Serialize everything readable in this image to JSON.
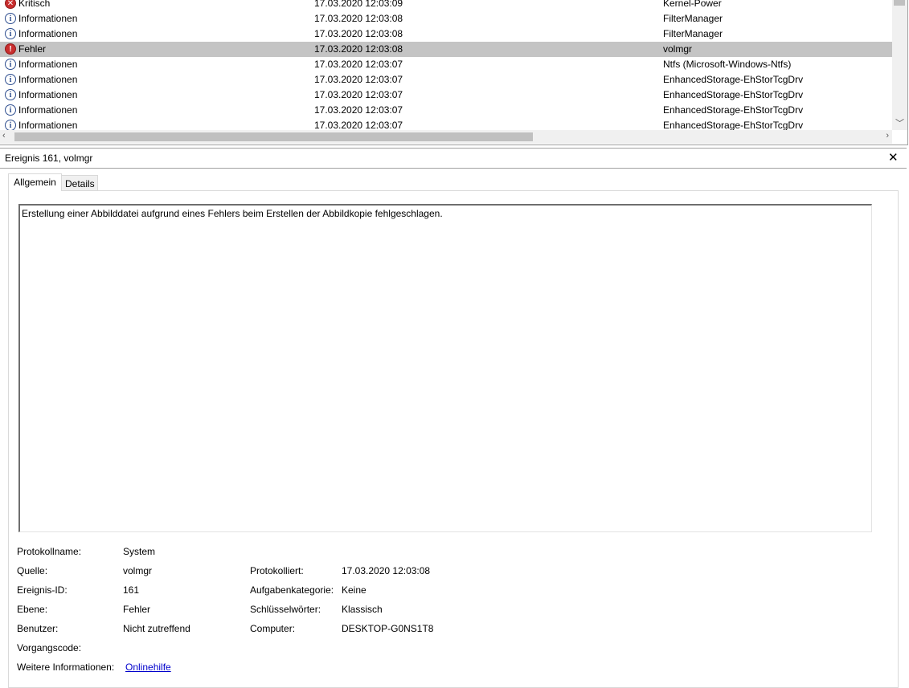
{
  "events": [
    {
      "level": "Kritisch",
      "icon": "critical-icon",
      "date": "17.03.2020 12:03:09",
      "source": "Kernel-Power",
      "selected": false
    },
    {
      "level": "Informationen",
      "icon": "info-icon",
      "date": "17.03.2020 12:03:08",
      "source": "FilterManager",
      "selected": false
    },
    {
      "level": "Informationen",
      "icon": "info-icon",
      "date": "17.03.2020 12:03:08",
      "source": "FilterManager",
      "selected": false
    },
    {
      "level": "Fehler",
      "icon": "error-icon",
      "date": "17.03.2020 12:03:08",
      "source": "volmgr",
      "selected": true
    },
    {
      "level": "Informationen",
      "icon": "info-icon",
      "date": "17.03.2020 12:03:07",
      "source": "Ntfs (Microsoft-Windows-Ntfs)",
      "selected": false
    },
    {
      "level": "Informationen",
      "icon": "info-icon",
      "date": "17.03.2020 12:03:07",
      "source": "EnhancedStorage-EhStorTcgDrv",
      "selected": false
    },
    {
      "level": "Informationen",
      "icon": "info-icon",
      "date": "17.03.2020 12:03:07",
      "source": "EnhancedStorage-EhStorTcgDrv",
      "selected": false
    },
    {
      "level": "Informationen",
      "icon": "info-icon",
      "date": "17.03.2020 12:03:07",
      "source": "EnhancedStorage-EhStorTcgDrv",
      "selected": false
    },
    {
      "level": "Informationen",
      "icon": "info-icon",
      "date": "17.03.2020 12:03:07",
      "source": "EnhancedStorage-EhStorTcgDrv",
      "selected": false
    }
  ],
  "detail": {
    "title": "Ereignis 161, volmgr",
    "close_glyph": "✕",
    "tabs": {
      "general": "Allgemein",
      "details": "Details"
    },
    "message": "Erstellung einer Abbilddatei aufgrund eines Fehlers beim Erstellen der Abbildkopie fehlgeschlagen."
  },
  "properties": {
    "log_name_label": "Protokollname:",
    "log_name": "System",
    "source_label": "Quelle:",
    "source": "volmgr",
    "logged_label": "Protokolliert:",
    "logged": "17.03.2020 12:03:08",
    "event_id_label": "Ereignis-ID:",
    "event_id": "161",
    "task_category_label": "Aufgabenkategorie:",
    "task_category": "Keine",
    "level_label": "Ebene:",
    "level": "Fehler",
    "keywords_label": "Schlüsselwörter:",
    "keywords": "Klassisch",
    "user_label": "Benutzer:",
    "user": "Nicht zutreffend",
    "computer_label": "Computer:",
    "computer": "DESKTOP-G0NS1T8",
    "opcode_label": "Vorgangscode:",
    "opcode": "",
    "more_info_label": "Weitere Informationen:",
    "more_info_link": "Onlinehilfe"
  },
  "colors": {
    "selected_row": "#c4c4c4",
    "link": "#0000cc",
    "error": "#c92e2e",
    "info": "#2e4e8f"
  }
}
